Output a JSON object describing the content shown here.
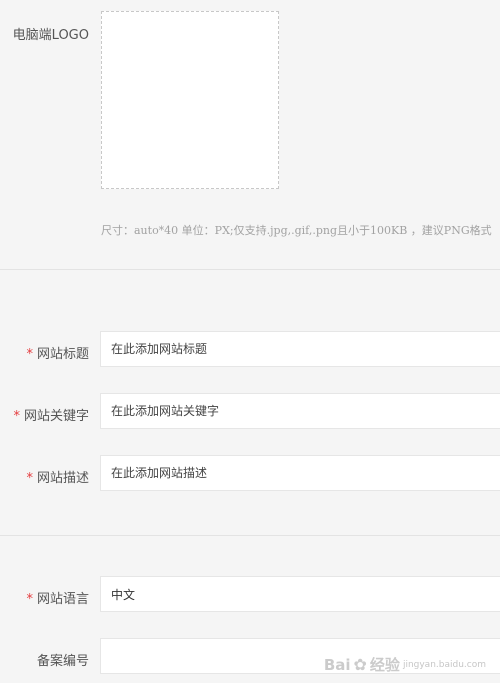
{
  "logo_section": {
    "label": "电脑端LOGO",
    "hint": "尺寸：auto*40 单位：PX;仅支持.jpg,.gif,.png且小于100KB ，建议PNG格式"
  },
  "required_mark": "*",
  "fields": [
    {
      "label": "网站标题",
      "placeholder": "在此添加网站标题",
      "value": "",
      "required": true
    },
    {
      "label": "网站关键字",
      "placeholder": "在此添加网站关键字",
      "value": "",
      "required": true
    },
    {
      "label": "网站描述",
      "placeholder": "在此添加网站描述",
      "value": "",
      "required": true
    },
    {
      "label": "网站语言",
      "placeholder": "",
      "value": "中文",
      "required": true
    },
    {
      "label": "备案编号",
      "placeholder": "",
      "value": "",
      "required": false
    }
  ],
  "watermark": {
    "text": "Bai",
    "paw_icon": "paw-icon",
    "text2": "经验",
    "sub": "jingyan.baidu.com"
  }
}
